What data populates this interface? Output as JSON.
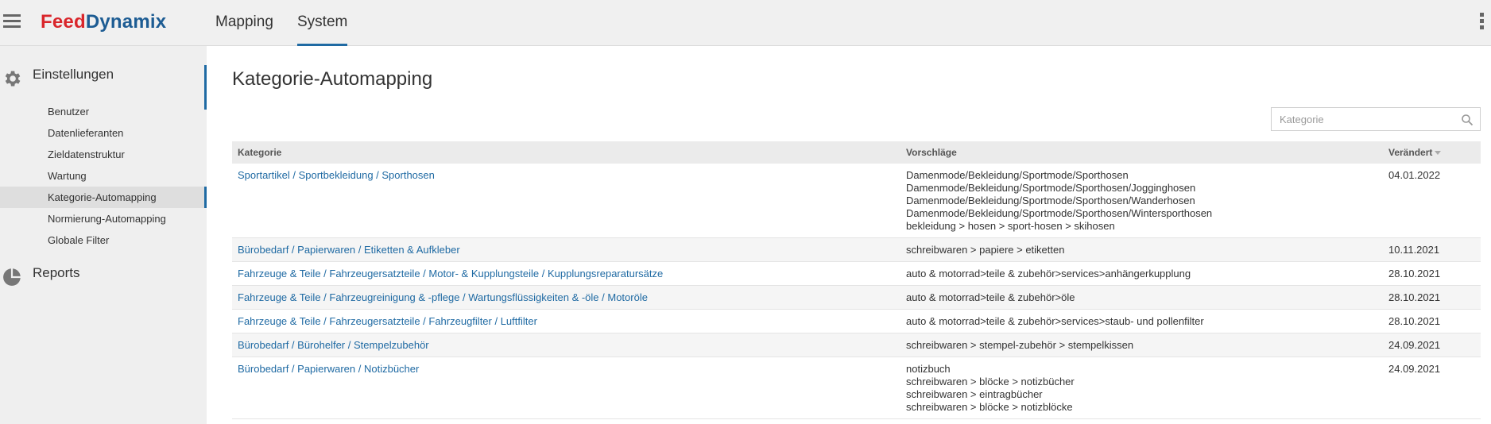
{
  "header": {
    "logo": {
      "part1": "Feed",
      "part2": "Dynamix"
    },
    "tabs": [
      {
        "label": "Mapping",
        "active": false
      },
      {
        "label": "System",
        "active": true
      }
    ],
    "accent_color": "#1f6aa3",
    "logo_red": "#d9262b"
  },
  "sidebar": {
    "sections": [
      {
        "label": "Einstellungen",
        "icon": "gear-icon"
      },
      {
        "label": "Reports",
        "icon": "pie-chart-icon"
      }
    ],
    "items": [
      {
        "label": "Benutzer"
      },
      {
        "label": "Datenlieferanten"
      },
      {
        "label": "Zieldatenstruktur"
      },
      {
        "label": "Wartung"
      },
      {
        "label": "Kategorie-Automapping",
        "active": true
      },
      {
        "label": "Normierung-Automapping"
      },
      {
        "label": "Globale Filter"
      }
    ]
  },
  "main": {
    "title": "Kategorie-Automapping",
    "search": {
      "placeholder": "Kategorie",
      "value": ""
    },
    "table": {
      "columns": [
        "Kategorie",
        "Vorschläge",
        "Verändert"
      ],
      "rows": [
        {
          "kategorie": "Sportartikel / Sportbekleidung / Sporthosen",
          "vorschlaege": [
            "Damenmode/Bekleidung/Sportmode/Sporthosen",
            "Damenmode/Bekleidung/Sportmode/Sporthosen/Jogginghosen",
            "Damenmode/Bekleidung/Sportmode/Sporthosen/Wanderhosen",
            "Damenmode/Bekleidung/Sportmode/Sporthosen/Wintersporthosen",
            "bekleidung > hosen > sport-hosen > skihosen"
          ],
          "veraendert": "04.01.2022"
        },
        {
          "kategorie": "Bürobedarf / Papierwaren / Etiketten & Aufkleber",
          "vorschlaege": [
            "schreibwaren > papiere > etiketten"
          ],
          "veraendert": "10.11.2021"
        },
        {
          "kategorie": "Fahrzeuge & Teile / Fahrzeugersatzteile / Motor- & Kupplungsteile / Kupplungsreparatursätze",
          "vorschlaege": [
            "auto & motorrad>teile & zubehör>services>anhängerkupplung"
          ],
          "veraendert": "28.10.2021"
        },
        {
          "kategorie": "Fahrzeuge & Teile / Fahrzeugreinigung & -pflege / Wartungsflüssigkeiten & -öle / Motoröle",
          "vorschlaege": [
            "auto & motorrad>teile & zubehör>öle"
          ],
          "veraendert": "28.10.2021"
        },
        {
          "kategorie": "Fahrzeuge & Teile / Fahrzeugersatzteile / Fahrzeugfilter / Luftfilter",
          "vorschlaege": [
            "auto & motorrad>teile & zubehör>services>staub- und pollenfilter"
          ],
          "veraendert": "28.10.2021"
        },
        {
          "kategorie": "Bürobedarf / Bürohelfer / Stempelzubehör",
          "vorschlaege": [
            "schreibwaren > stempel-zubehör > stempelkissen"
          ],
          "veraendert": "24.09.2021"
        },
        {
          "kategorie": "Bürobedarf / Papierwaren / Notizbücher",
          "vorschlaege": [
            "notizbuch",
            "schreibwaren > blöcke > notizbücher",
            "schreibwaren > eintragbücher",
            "schreibwaren > blöcke > notizblöcke"
          ],
          "veraendert": "24.09.2021"
        }
      ]
    }
  }
}
